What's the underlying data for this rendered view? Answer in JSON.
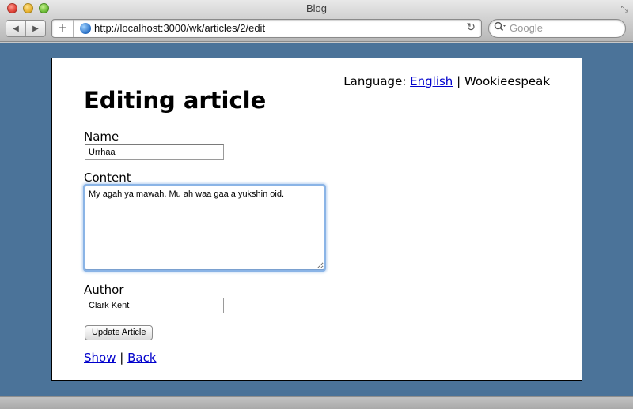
{
  "window": {
    "title": "Blog",
    "resize_icon": "⤡"
  },
  "toolbar": {
    "back_icon": "◀",
    "forward_icon": "▶",
    "add_tab_icon": "+",
    "url": "http://localhost:3000/wk/articles/2/edit",
    "reload_icon": "↻",
    "search_icon": "🔍",
    "search_placeholder": "Google"
  },
  "page": {
    "language_label": "Language:",
    "language_links": [
      "English",
      "Wookieespeak"
    ],
    "language_separator": "|",
    "heading": "Editing article",
    "form": {
      "name_label": "Name",
      "name_value": "Urrhaa",
      "content_label": "Content",
      "content_value": "My agah ya mawah. Mu ah waa gaa a yukshin oid.",
      "author_label": "Author",
      "author_value": "Clark Kent",
      "submit_label": "Update Article"
    },
    "footer_links": [
      "Show",
      "Back"
    ],
    "footer_separator": "|"
  },
  "colors": {
    "viewport_background": "#4b7399",
    "link": "#0000cc",
    "focus_ring": "#8ab4e6"
  }
}
